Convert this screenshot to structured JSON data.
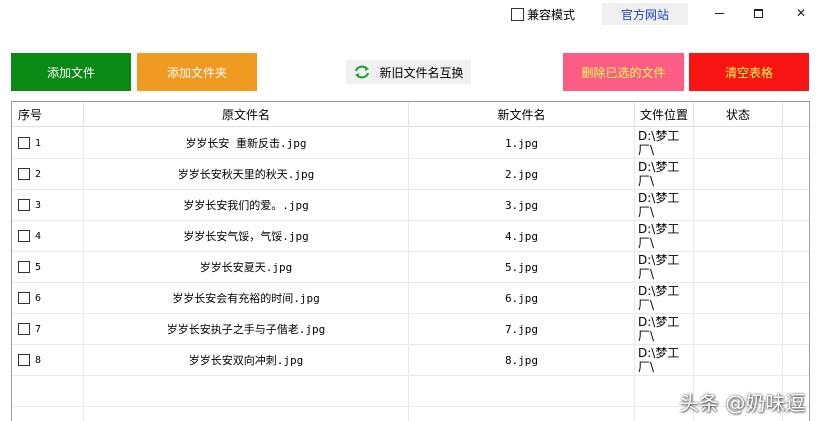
{
  "titlebar": {
    "compat_label": "兼容模式",
    "official_site": "官方网站",
    "minimize": "—",
    "close": "✕"
  },
  "toolbar": {
    "add_file": "添加文件",
    "add_folder": "添加文件夹",
    "swap_names": "新旧文件名互换",
    "delete_selected": "删除已选的文件",
    "clear_table": "清空表格"
  },
  "table": {
    "columns": [
      "序号",
      "原文件名",
      "新文件名",
      "文件位置",
      "状态"
    ],
    "rows": [
      {
        "num": "1",
        "original": "岁岁长安  重新反击.jpg",
        "new": "1.jpg",
        "location": "D:\\梦工\n厂\\",
        "status": ""
      },
      {
        "num": "2",
        "original": "岁岁长安秋天里的秋天.jpg",
        "new": "2.jpg",
        "location": "D:\\梦工\n厂\\",
        "status": ""
      },
      {
        "num": "3",
        "original": "岁岁长安我们的爱。.jpg",
        "new": "3.jpg",
        "location": "D:\\梦工\n厂\\",
        "status": ""
      },
      {
        "num": "4",
        "original": "岁岁长安气馁，气馁.jpg",
        "new": "4.jpg",
        "location": "D:\\梦工\n厂\\",
        "status": ""
      },
      {
        "num": "5",
        "original": "岁岁长安夏天.jpg",
        "new": "5.jpg",
        "location": "D:\\梦工\n厂\\",
        "status": ""
      },
      {
        "num": "6",
        "original": "岁岁长安会有充裕的时间.jpg",
        "new": "6.jpg",
        "location": "D:\\梦工\n厂\\",
        "status": ""
      },
      {
        "num": "7",
        "original": "岁岁长安执子之手与子偕老.jpg",
        "new": "7.jpg",
        "location": "D:\\梦工\n厂\\",
        "status": ""
      },
      {
        "num": "8",
        "original": "岁岁长安双向冲刺.jpg",
        "new": "8.jpg",
        "location": "D:\\梦工\n厂\\",
        "status": ""
      }
    ]
  },
  "watermark": "头条 @奶味逗",
  "colors": {
    "add_file": "#0a8a14",
    "add_folder": "#f09a21",
    "delete_selected": "#fb5d85",
    "clear_table": "#f91414",
    "warn_text": "#ffff55",
    "link": "#1a3fc4"
  },
  "icons": {
    "swap": "refresh-arrows-icon",
    "checkbox": "checkbox-icon",
    "minimize": "minimize-icon",
    "maximize": "maximize-icon",
    "close": "close-icon"
  }
}
